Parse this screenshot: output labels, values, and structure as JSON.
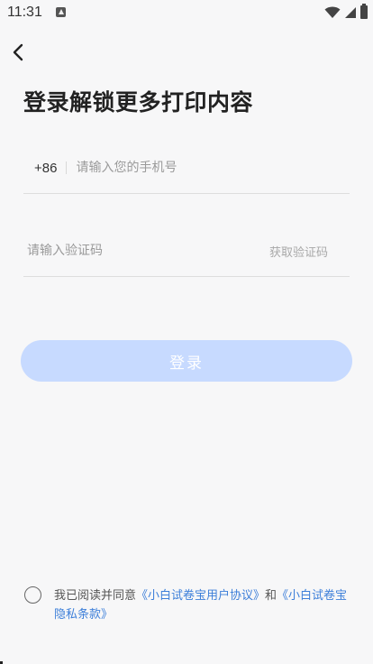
{
  "status_bar": {
    "time": "11:31"
  },
  "header": {
    "back_icon": "chevron-left-icon",
    "title": "登录解锁更多打印内容"
  },
  "phone_field": {
    "country_code": "+86",
    "placeholder": "请输入您的手机号",
    "value": ""
  },
  "code_field": {
    "placeholder": "请输入验证码",
    "value": "",
    "get_code_label": "获取验证码"
  },
  "login_button": {
    "label": "登录",
    "color": "#c7daff"
  },
  "agreement": {
    "prefix": "我已阅读并同意",
    "user_agreement": "《小白试卷宝用户协议》",
    "conjunction": "和",
    "privacy_policy": "《小白试卷宝隐私条款》",
    "checked": false,
    "link_color": "#3d7fd9"
  }
}
